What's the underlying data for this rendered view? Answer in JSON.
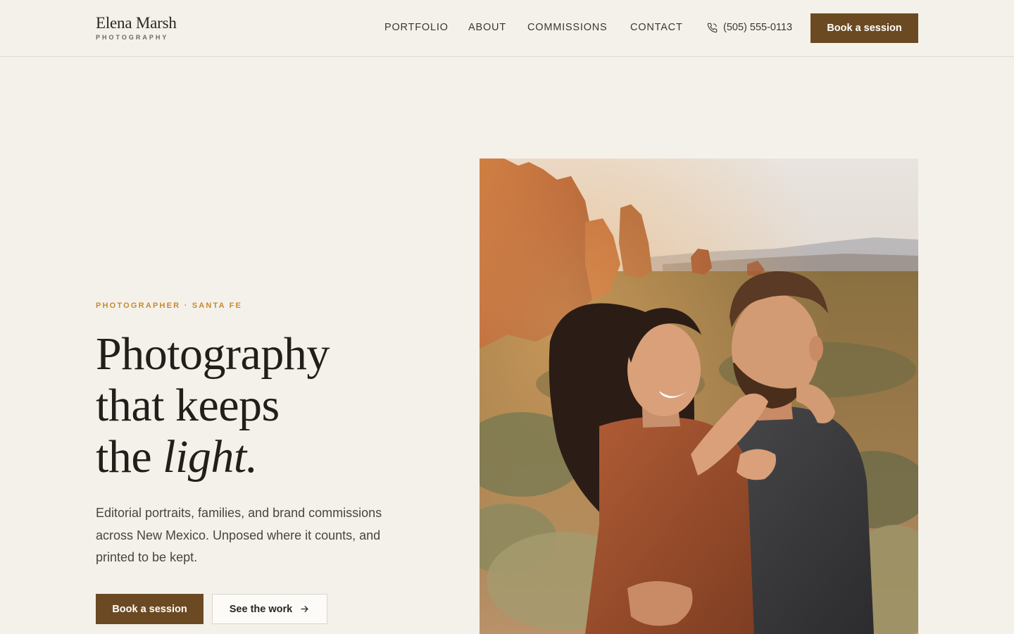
{
  "brand": {
    "name": "Elena Marsh",
    "tagline": "PHOTOGRAPHY"
  },
  "nav": {
    "items": [
      {
        "label": "PORTFOLIO"
      },
      {
        "label": "ABOUT"
      },
      {
        "label": "COMMISSIONS"
      },
      {
        "label": "CONTACT"
      }
    ],
    "phone": "(505) 555-0113",
    "cta": "Book a session"
  },
  "hero": {
    "eyebrow": "PHOTOGRAPHER · SANTA FE",
    "headline_line1": "Photography",
    "headline_line2": "that keeps",
    "headline_line3_prefix": "the ",
    "headline_line3_italic": "light.",
    "lede": "Editorial portraits, families, and brand commissions across New Mexico. Unposed where it counts, and printed to be kept.",
    "primary_cta": "Book a session",
    "secondary_cta": "See the work"
  },
  "icons": {
    "phone": "phone-icon",
    "arrow": "arrow-right-icon"
  },
  "colors": {
    "background": "#f4f1eb",
    "accent": "#6b4a23",
    "eyebrow": "#c8892f",
    "text": "#2a2622"
  }
}
